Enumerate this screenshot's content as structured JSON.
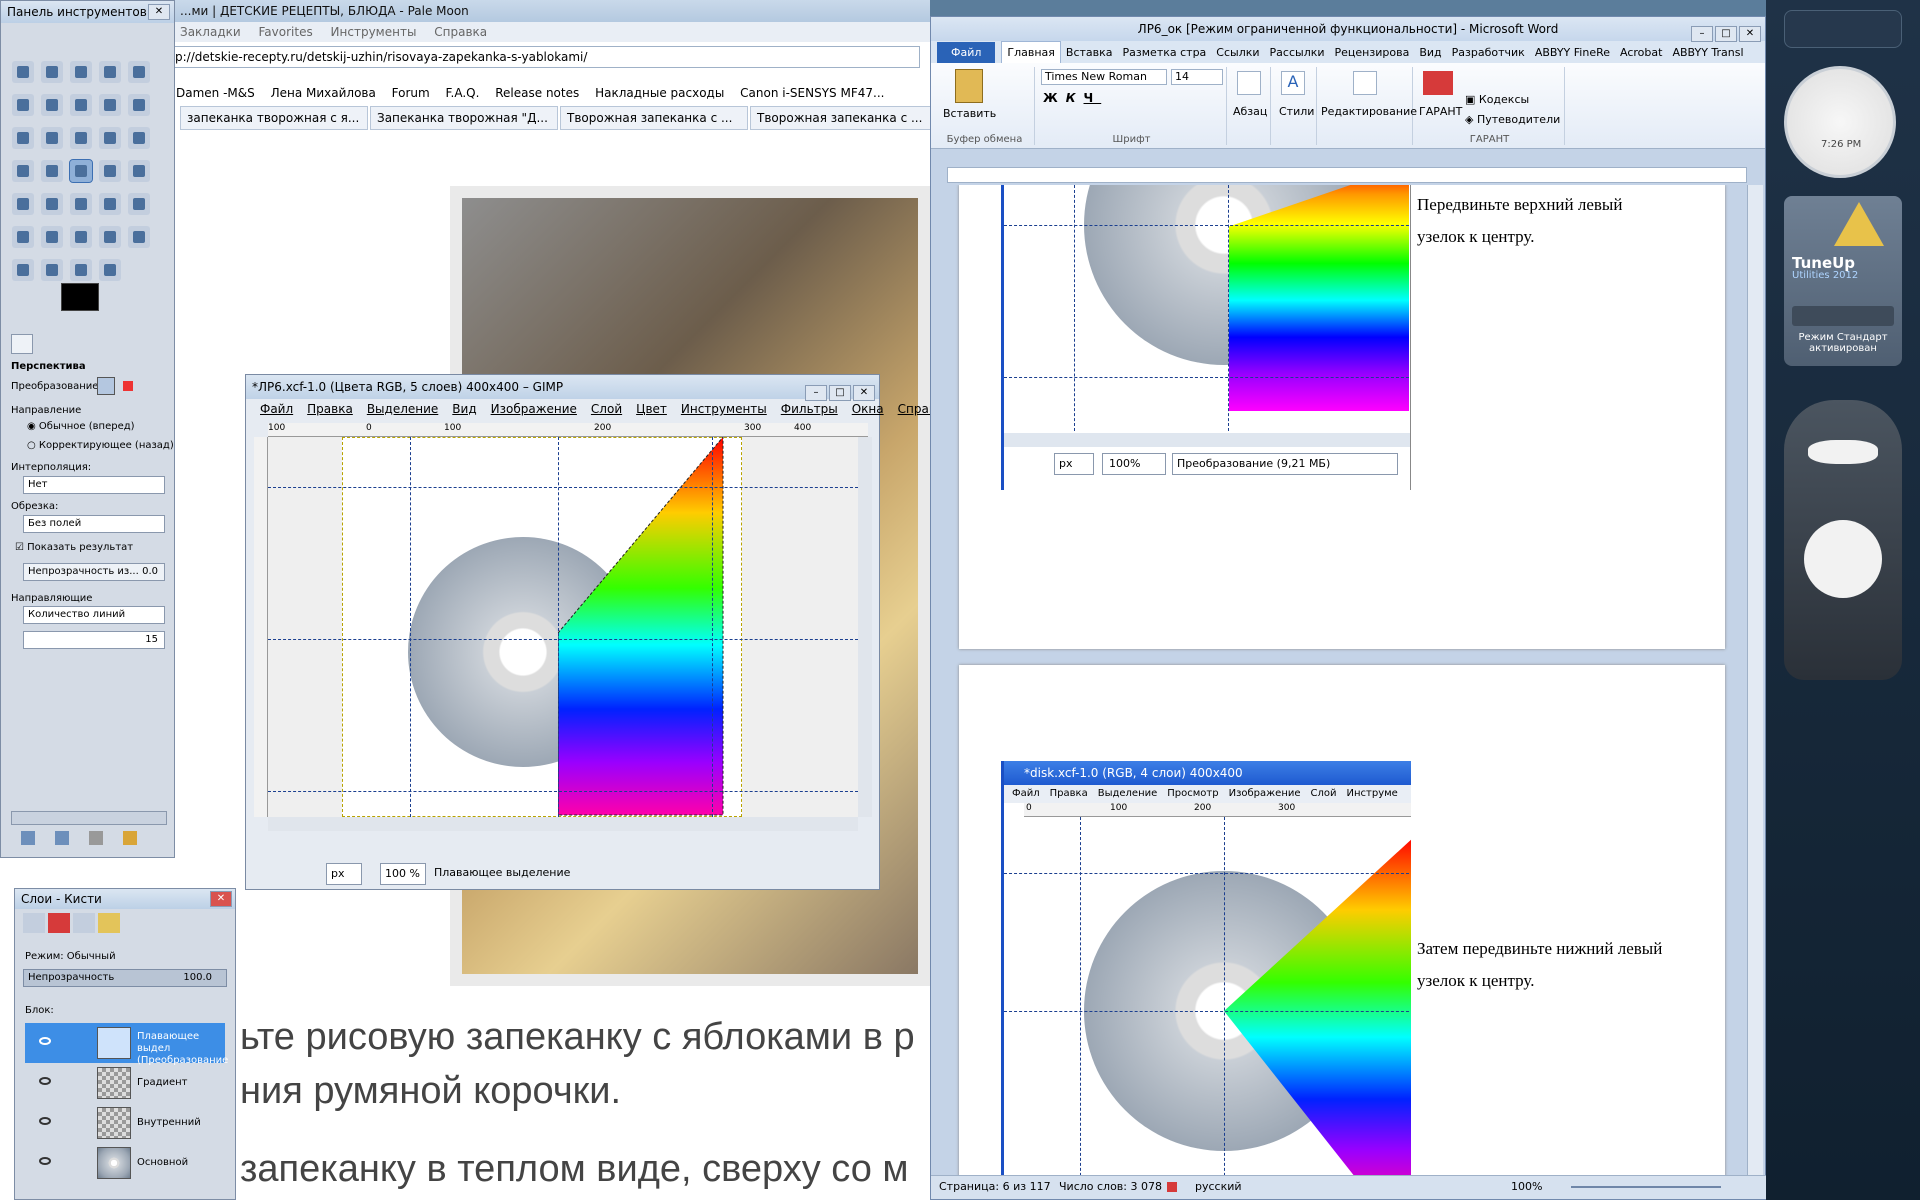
{
  "browser": {
    "title": "...ми | ДЕТСКИЕ РЕЦЕПТЫ, БЛЮДА - Pale Moon",
    "menu": [
      "Закладки",
      "Favorites",
      "Инструменты",
      "Справка"
    ],
    "url": "p://detskie-recepty.ru/detskij-uzhin/risovaya-zapekanka-s-yablokami/",
    "bookmarks": [
      "Damen -M&S",
      "Лена Михайлова",
      "Forum",
      "F.A.Q.",
      "Release notes",
      "Накладные расходы",
      "Canon i-SENSYS MF47..."
    ],
    "tabs": [
      "запеканка творожная с я...",
      "Запеканка творожная \"Д...",
      "Творожная запеканка с ...",
      "Творожная запеканка с ..."
    ],
    "body_line1": "ьте рисовую запеканку с яблоками в р",
    "body_line2": "ния румяной корочки.",
    "body_line3": "запеканку в теплом виде, сверху со м"
  },
  "toolbox": {
    "title": "Панель инструментов - ...",
    "tool_name": "Перспектива",
    "transform_label": "Преобразование:",
    "direction_label": "Направление",
    "dir_forward": "Обычное (вперед)",
    "dir_backward": "Корректирующее (назад)",
    "interp_label": "Интерполяция:",
    "interp_value": "Нет",
    "clip_label": "Обрезка:",
    "clip_value": "Без полей",
    "show_result": "Показать результат",
    "opacity_label": "Непрозрачность из...",
    "opacity_value": "0.0",
    "guides_label": "Направляющие",
    "guides_value": "Количество линий",
    "lines_value": "15"
  },
  "layers": {
    "title": "Слои - Кисти",
    "mode_label": "Режим:",
    "mode_value": "Обычный",
    "opacity_label": "Непрозрачность",
    "opacity_value": "100.0",
    "lock_label": "Блок:",
    "rows": [
      {
        "name": "Плавающее выдел (Преобразование",
        "selected": true
      },
      {
        "name": "Градиент",
        "selected": false
      },
      {
        "name": "Внутренний",
        "selected": false
      },
      {
        "name": "Основной",
        "selected": false
      }
    ]
  },
  "gimp": {
    "title": "*ЛР6.xcf-1.0 (Цвета RGB, 5 слоев) 400x400 – GIMP",
    "menu": [
      "Файл",
      "Правка",
      "Выделение",
      "Вид",
      "Изображение",
      "Слой",
      "Цвет",
      "Инструменты",
      "Фильтры",
      "Окна",
      "Справк"
    ],
    "ruler": [
      "100",
      "0",
      "100",
      "200",
      "300",
      "400"
    ],
    "unit": "px",
    "zoom": "100 %",
    "status": "Плавающее выделение"
  },
  "word": {
    "title": "ЛР6_ок [Режим ограниченной функциональности] - Microsoft Word",
    "tabs": [
      "Файл",
      "Главная",
      "Вставка",
      "Разметка стра",
      "Ссылки",
      "Рассылки",
      "Рецензирова",
      "Вид",
      "Разработчик",
      "ABBYY FineRe",
      "Acrobat",
      "ABBYY Transl"
    ],
    "paste": "Вставить",
    "clipboard": "Буфер обмена",
    "font_name": "Times New Roman",
    "font_size": "14",
    "font_group": "Шрифт",
    "paragraph": "Абзац",
    "styles": "Стили",
    "editing": "Редактирование",
    "garant": "ГАРАНТ",
    "codecs": "Кодексы",
    "guides": "Путеводители",
    "text1a": "Передвиньте верхний левый",
    "text1b": "узелок к центру.",
    "text2a": "Затем передвиньте нижний левый",
    "text2b": "узелок к центру.",
    "embed1_unit": "px",
    "embed1_zoom": "100%",
    "embed1_status": "Преобразование (9,21 МБ)",
    "embed2_title": "*disk.xcf-1.0 (RGB, 4 слои) 400x400",
    "embed2_menu": [
      "Файл",
      "Правка",
      "Выделение",
      "Просмотр",
      "Изображение",
      "Слой",
      "Инструме"
    ],
    "embed2_ruler": [
      "0",
      "100",
      "200",
      "300"
    ],
    "status_page": "Страница: 6 из 117",
    "status_words": "Число слов: 3 078",
    "status_lang": "русский",
    "status_zoom": "100%"
  },
  "sidebar": {
    "clock_time": "7:26 PM",
    "tuneup_title": "TuneUp",
    "tuneup_sub": "Utilities 2012",
    "tuneup_mode": "Режим Стандарт активирован"
  }
}
